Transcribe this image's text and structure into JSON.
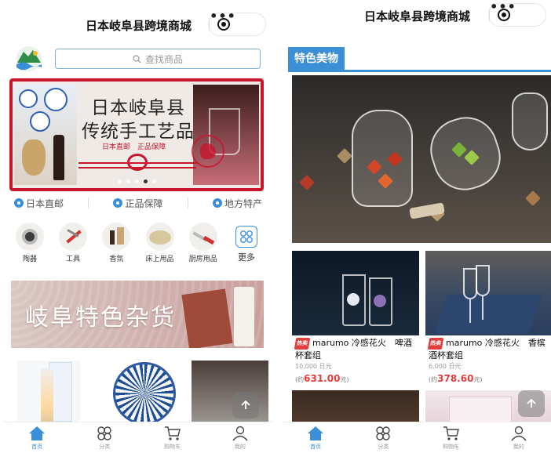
{
  "app": {
    "title": "日本岐阜县跨境商城",
    "more_glyph": "•••"
  },
  "search": {
    "placeholder": "查找商品"
  },
  "banner": {
    "title_line1": "日本岐阜县",
    "title_line2": "传统手工艺品",
    "subtitle": "日本直邮　正品保障"
  },
  "features": [
    "日本直邮",
    "正品保障",
    "地方特产"
  ],
  "categories": [
    "陶器",
    "工具",
    "香氛",
    "床上用品",
    "厨房用品",
    "更多"
  ],
  "promo": {
    "title": "岐阜特色杂货"
  },
  "tabbar": [
    {
      "label": "首页",
      "icon": "home-icon"
    },
    {
      "label": "分类",
      "icon": "category-icon"
    },
    {
      "label": "购物车",
      "icon": "cart-icon"
    },
    {
      "label": "我的",
      "icon": "user-icon"
    }
  ],
  "section": {
    "title": "特色美物"
  },
  "products": [
    {
      "badge": "热卖",
      "name": "marumo 冷感花火　啤酒杯套组",
      "price_jpy": "10,000 日元",
      "price_cny_prefix": "(约",
      "price_cny": "631.00",
      "price_cny_suffix": "元)"
    },
    {
      "badge": "热卖",
      "name": "marumo 冷感花火　香槟酒杯套组",
      "price_jpy": "6,000 日元",
      "price_cny_prefix": "(约",
      "price_cny": "378.60",
      "price_cny_suffix": "元)"
    }
  ],
  "colors": {
    "accent": "#3b8fd6",
    "price": "#e23e3e",
    "banner_red": "#c8162d"
  }
}
